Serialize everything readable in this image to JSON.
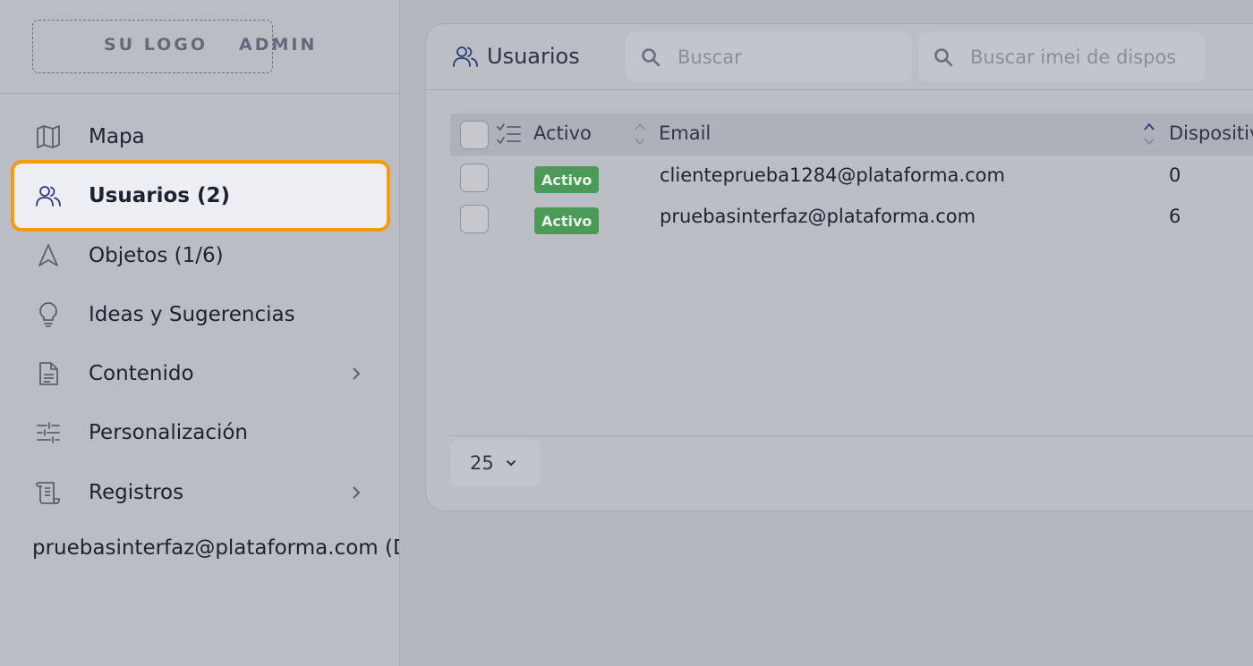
{
  "brand": {
    "logo_text": "SU LOGO",
    "badge_text": "ADMIN"
  },
  "sidebar": {
    "items": [
      {
        "label": "Mapa",
        "icon": "map-icon"
      },
      {
        "label": "Usuarios (2)",
        "icon": "users-icon",
        "active": true
      },
      {
        "label": "Objetos (1/6)",
        "icon": "navigation-icon"
      },
      {
        "label": "Ideas y Sugerencias",
        "icon": "lightbulb-icon"
      },
      {
        "label": "Contenido",
        "icon": "document-icon",
        "has_submenu": true
      },
      {
        "label": "Personalización",
        "icon": "sliders-icon"
      },
      {
        "label": "Registros",
        "icon": "scroll-icon",
        "has_submenu": true
      }
    ],
    "current_user": "pruebasinterfaz@plataforma.com (D"
  },
  "panel": {
    "title": "Usuarios",
    "search": {
      "placeholder": "Buscar"
    },
    "imei_search": {
      "placeholder": "Buscar imei de dispositi"
    }
  },
  "table": {
    "columns": [
      "Activo",
      "Email",
      "Dispositiv"
    ],
    "rows": [
      {
        "status": "Activo",
        "email": "clienteprueba1284@plataforma.com",
        "devices": "0"
      },
      {
        "status": "Activo",
        "email": "pruebasinterfaz@plataforma.com",
        "devices": "6"
      }
    ]
  },
  "pagination": {
    "page_size": "25"
  },
  "colors": {
    "active_outline": "#f39c12",
    "badge_green": "#4c9a58",
    "overlay_bg": "#b4b6c0"
  }
}
